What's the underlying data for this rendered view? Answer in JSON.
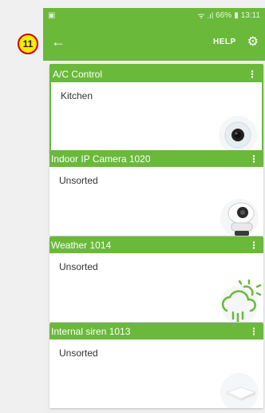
{
  "annotation": {
    "label": "11"
  },
  "status_bar": {
    "signal": "ᯤ .ıl",
    "battery": "66%",
    "time": "13:11"
  },
  "app_bar": {
    "back_icon": "arrow-left-icon",
    "help_label": "HELP",
    "settings_icon": "gear-icon"
  },
  "devices": [
    {
      "name": "A/C Control",
      "room": "Kitchen",
      "icon": "ac-control-icon",
      "selected": true
    },
    {
      "name": "Indoor IP Camera 1020",
      "room": "Unsorted",
      "icon": "ip-camera-icon",
      "selected": false
    },
    {
      "name": "Weather 1014",
      "room": "Unsorted",
      "icon": "weather-icon",
      "selected": false
    },
    {
      "name": "Internal siren 1013",
      "room": "Unsorted",
      "icon": "siren-icon",
      "selected": false
    }
  ],
  "colors": {
    "accent": "#6ab93a",
    "background": "#efefef",
    "card": "#ffffff"
  }
}
